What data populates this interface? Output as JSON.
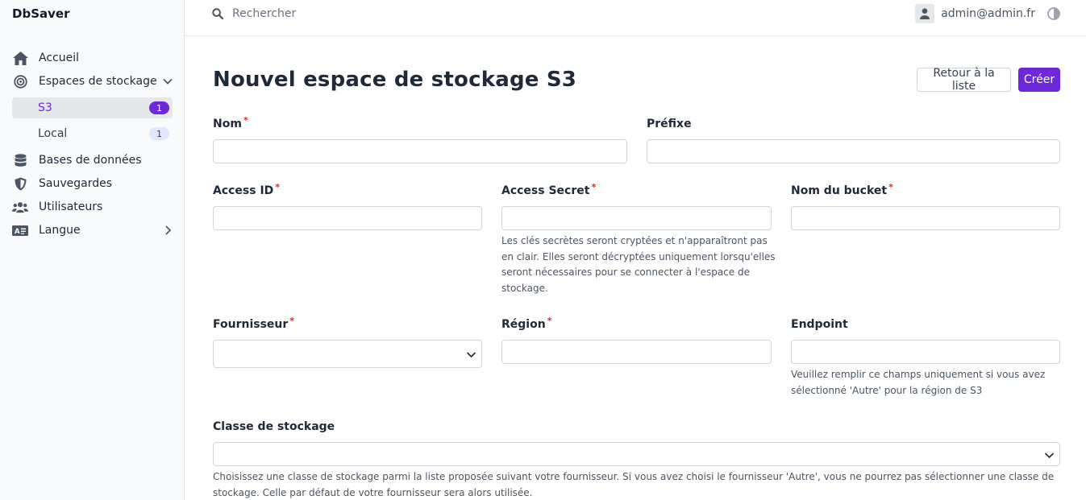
{
  "app": {
    "name": "DbSaver"
  },
  "sidebar": {
    "items": [
      {
        "label": "Accueil"
      },
      {
        "label": "Espaces de stockage"
      },
      {
        "label": "S3",
        "badge": "1"
      },
      {
        "label": "Local",
        "badge": "1"
      },
      {
        "label": "Bases de données"
      },
      {
        "label": "Sauvegardes"
      },
      {
        "label": "Utilisateurs"
      },
      {
        "label": "Langue"
      }
    ]
  },
  "topbar": {
    "search_placeholder": "Rechercher",
    "user_email": "admin@admin.fr"
  },
  "page": {
    "title": "Nouvel espace de stockage S3",
    "back_button": "Retour à la liste",
    "create_button": "Créer"
  },
  "form": {
    "nom": {
      "label": "Nom",
      "required": "*",
      "value": ""
    },
    "prefixe": {
      "label": "Préfixe",
      "value": ""
    },
    "access_id": {
      "label": "Access ID",
      "required": "*",
      "value": ""
    },
    "access_secret": {
      "label": "Access Secret",
      "required": "*",
      "value": "",
      "help": "Les clés secrètes seront cryptées et n'apparaîtront pas en clair. Elles seront décryptées uniquement lorsqu'elles seront nécessaires pour se connecter à l'espace de stockage."
    },
    "bucket": {
      "label": "Nom du bucket",
      "required": "*",
      "value": ""
    },
    "fournisseur": {
      "label": "Fournisseur",
      "required": "*",
      "value": ""
    },
    "region": {
      "label": "Région",
      "required": "*",
      "value": ""
    },
    "endpoint": {
      "label": "Endpoint",
      "value": "",
      "help": "Veuillez remplir ce champs uniquement si vous avez sélectionné 'Autre' pour la région de S3"
    },
    "classe": {
      "label": "Classe de stockage",
      "value": "",
      "help": "Choisissez une classe de stockage parmi la liste proposée suivant votre fournisseur. Si vous avez choisi le fournisseur 'Autre', vous ne pourrez pas sélectionner une classe de stockage. Celle par défaut de votre fournisseur sera alors utilisée."
    }
  },
  "colors": {
    "accent": "#6d28d9",
    "required": "#dc2626"
  },
  "icons": [
    "home-icon",
    "target-icon",
    "chevron-down-icon",
    "database-icon",
    "shield-icon",
    "users-icon",
    "id-card-icon",
    "chevron-right-icon",
    "search-icon",
    "user-icon",
    "contrast-icon"
  ]
}
